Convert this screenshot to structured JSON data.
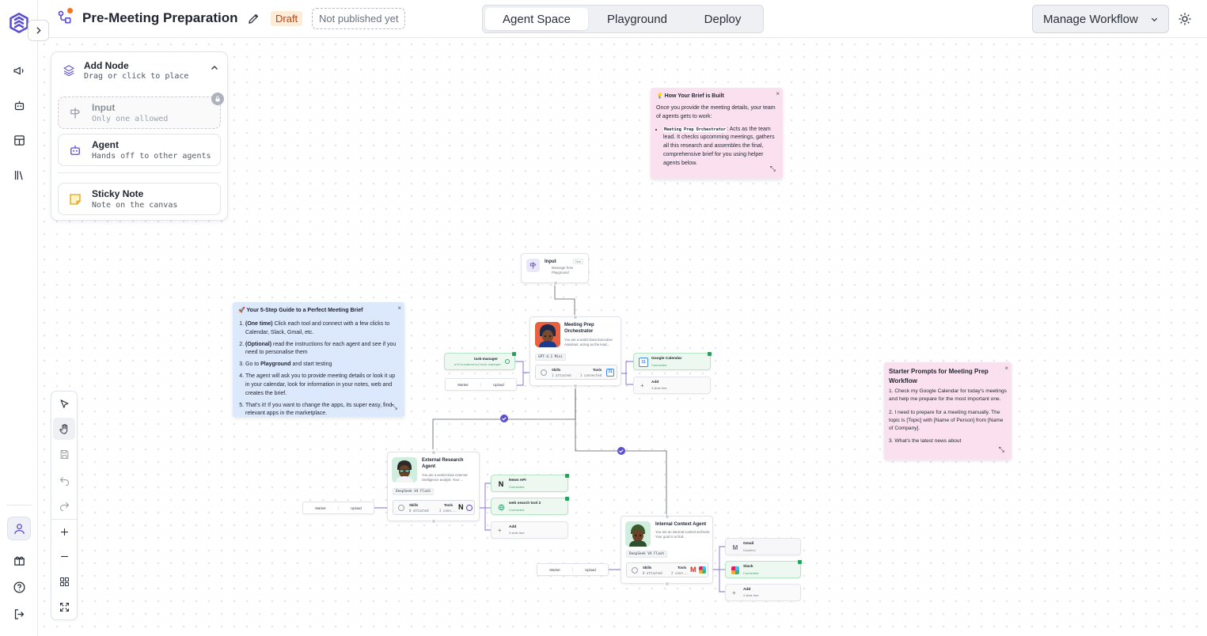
{
  "header": {
    "title": "Pre-Meeting Preparation",
    "draft": "Draft",
    "publish_status": "Not published yet",
    "tabs": [
      "Agent Space",
      "Playground",
      "Deploy"
    ],
    "active_tab": "Agent Space",
    "manage_label": "Manage Workflow"
  },
  "add_node": {
    "title": "Add Node",
    "subtitle": "Drag or click to place",
    "options": [
      {
        "title": "Input",
        "subtitle": "Only one allowed"
      },
      {
        "title": "Agent",
        "subtitle": "Hands off to other agents"
      },
      {
        "title": "Sticky Note",
        "subtitle": "Note on the canvas"
      }
    ]
  },
  "notes": {
    "brief": {
      "title": "💡 How Your Brief is Built",
      "intro": "Once you provide the meeting details, your team of agents gets to work:",
      "code": "Meeting Prep Orchestrator",
      "bullet": ": Acts as the team lead. It checks upcomming meetings, gathers all this research and assembles the final, comprehensive brief for you using helper agents below."
    },
    "guide": {
      "title": "🚀 Your 5-Step Guide to a Perfect Meeting Brief",
      "steps": [
        {
          "bold": "(One time)",
          "text": " Click each tool and connect with a few clicks to Calendar, Slack, Gmail, etc."
        },
        {
          "bold": "(Optional)",
          "text": " read the instructions for each agent and see if you need to personalise them"
        },
        {
          "pre": "Go to ",
          "bold": "Playground",
          "text": " and start testing"
        },
        {
          "text": "The agent will ask you to provide meeting details or look it up in your calendar, look for information in your notes, web and creates the brief."
        },
        {
          "text": "That's it! If you want to change the apps, its super easy, find relevant apps in the marketplace."
        }
      ]
    },
    "starter": {
      "title": "Starter Prompts for Meeting Prep Workflow",
      "p1": "1. Check my Google Calendar for today's meetings and help me prepare for the most important one.",
      "p2": "2. I need to prepare for a meeting manually. The topic is [Topic] with [Name of Person] from [Name of Company].",
      "p3": "3. What's the latest news about"
    }
  },
  "workflow": {
    "input": {
      "title": "Input",
      "badge": "Text",
      "desc": "Message from Playground"
    },
    "orchestrator": {
      "title": "Meeting Prep Orchestrator",
      "desc": "You are a world-class Executive Assistant, acting as the lead...",
      "model": "GPT-4.1 Mini",
      "skills": "Skills",
      "skills_val": "1 attached",
      "tools": "Tools",
      "tools_val": "1 connected"
    },
    "task_manager": {
      "name": "task-manager",
      "sub": "officiedevelo/task-manager"
    },
    "market": "Market",
    "upload": "Upload",
    "google_calendar": {
      "name": "Google Calendar",
      "status": "Connected"
    },
    "add": {
      "name": "Add",
      "sub_4": "4 slots free",
      "sub_3": "3 slots free"
    },
    "external": {
      "title": "External Research Agent",
      "desc": "You are a world-class external intelligence analyst. Your ...",
      "model": "DeepSeek V4 Flash",
      "skills_val": "0 attached",
      "tools_val": "2 conn..."
    },
    "news_api": {
      "name": "News API",
      "status": "Connected"
    },
    "web_search": {
      "name": "web search tool 2",
      "status": "Connected"
    },
    "internal": {
      "title": "Internal Context Agent",
      "desc": "You are an internal context archivist. Your goal is to find...",
      "model": "DeepSeek V4 Flash",
      "skills_val": "0 attached",
      "tools_val": "2 conn..."
    },
    "gmail": {
      "name": "Gmail",
      "status": "Disabled"
    },
    "slack": {
      "name": "Slack",
      "status": "Connected"
    }
  },
  "colors": {
    "accent": "#5b4fd1",
    "draft_bg": "#fdecd8",
    "note_pink": "#fbe1ef",
    "note_blue": "#dce8fc",
    "connected_green": "#ecf8f0"
  }
}
